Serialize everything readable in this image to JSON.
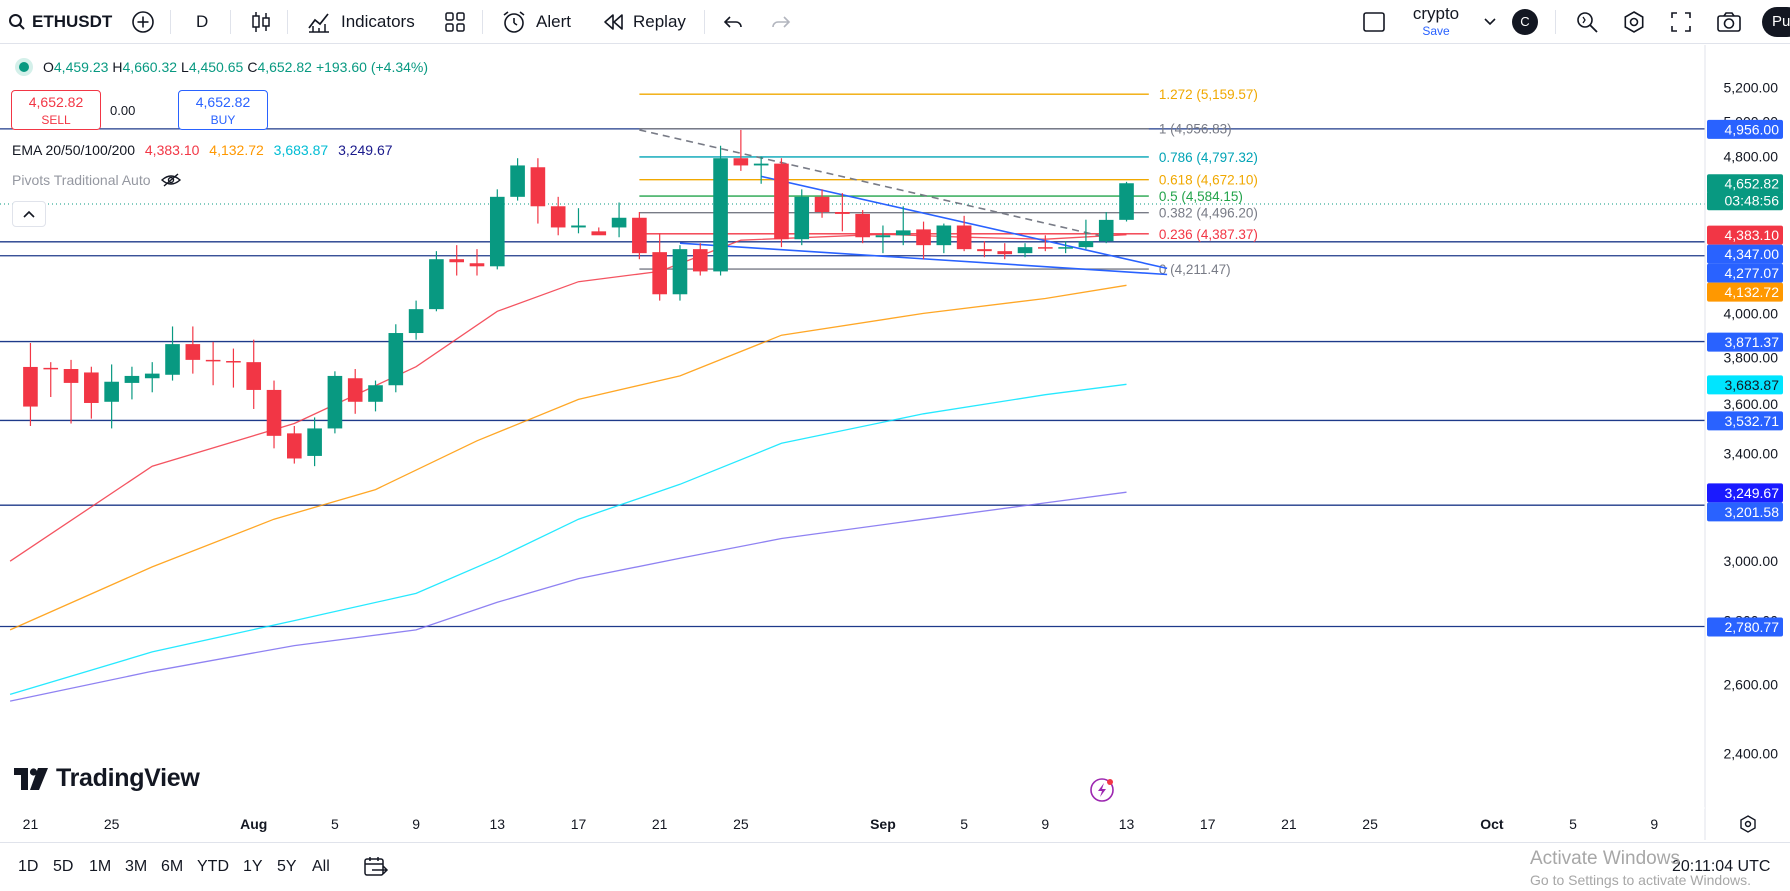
{
  "toolbar": {
    "symbol": "ETHUSDT",
    "interval": "D",
    "indicators_label": "Indicators",
    "alert_label": "Alert",
    "replay_label": "Replay",
    "layout_name": "crypto",
    "layout_save_label": "Save",
    "avatar_letter": "C",
    "publish_label": "Pu"
  },
  "legend": {
    "open_label": "O",
    "open": "4,459.23",
    "high_label": "H",
    "high": "4,660.32",
    "low_label": "L",
    "low": "4,450.65",
    "close_label": "C",
    "close": "4,652.82",
    "change": "+193.60 (+4.34%)"
  },
  "trade": {
    "sell_price": "4,652.82",
    "sell_label": "SELL",
    "buy_price": "4,652.82",
    "buy_label": "BUY",
    "spread": "0.00"
  },
  "ema": {
    "label": "EMA 20/50/100/200",
    "values": [
      "4,383.10",
      "4,132.72",
      "3,683.87",
      "3,249.67"
    ],
    "colors": [
      "#f23645",
      "#ff9800",
      "#00e5ff",
      "#3f2dbd"
    ]
  },
  "pivots_label": "Pivots Traditional Auto",
  "price_axis": {
    "ticks": [
      "5,200.00",
      "5,000.00",
      "4,800.00",
      "4,000.00",
      "3,800.00",
      "3,600.00",
      "3,400.00",
      "3,000.00",
      "2,800.00",
      "2,600.00",
      "2,400.00"
    ],
    "markers": [
      {
        "text": "4,956.00",
        "color": "#2962ff"
      },
      {
        "text": "4,652.82",
        "color": "#089981"
      },
      {
        "text": "03:48:56",
        "color": "#089981"
      },
      {
        "text": "4,383.10",
        "color": "#f23645"
      },
      {
        "text": "4,347.00",
        "color": "#2962ff"
      },
      {
        "text": "4,277.07",
        "color": "#2962ff"
      },
      {
        "text": "4,132.72",
        "color": "#ff9800"
      },
      {
        "text": "3,871.37",
        "color": "#2962ff"
      },
      {
        "text": "3,683.87",
        "color": "#00e5ff"
      },
      {
        "text": "3,532.71",
        "color": "#2962ff"
      },
      {
        "text": "3,249.67",
        "color": "#1a1aff"
      },
      {
        "text": "3,201.58",
        "color": "#2962ff"
      },
      {
        "text": "2,780.77",
        "color": "#2962ff"
      }
    ]
  },
  "time_axis": [
    "21",
    "25",
    "Aug",
    "5",
    "9",
    "13",
    "17",
    "21",
    "25",
    "Sep",
    "5",
    "9",
    "13",
    "17",
    "21",
    "25",
    "Oct",
    "5",
    "9"
  ],
  "fibonacci": [
    {
      "label": "1.272 (5,159.57)",
      "price": 5159.57,
      "color": "#f0a800"
    },
    {
      "label": "1 (4,956.83)",
      "price": 4956.83,
      "color": "#787b86"
    },
    {
      "label": "0.786 (4,797.32)",
      "price": 4797.32,
      "color": "#00a3b5"
    },
    {
      "label": "0.618 (4,672.10)",
      "price": 4672.1,
      "color": "#f0a800"
    },
    {
      "label": "0.5 (4,584.15)",
      "price": 4584.15,
      "color": "#22a34a"
    },
    {
      "label": "0.382 (4,496.20)",
      "price": 4496.2,
      "color": "#787b86"
    },
    {
      "label": "0.236 (4,387.37)",
      "price": 4387.37,
      "color": "#f23645"
    },
    {
      "label": "0 (4,211.47)",
      "price": 4211.47,
      "color": "#787b86"
    }
  ],
  "horizontal_levels": [
    4956.0,
    4347.0,
    4277.07,
    3871.37,
    3532.71,
    3201.58,
    2780.77
  ],
  "range_buttons": [
    "1D",
    "5D",
    "1M",
    "3M",
    "6M",
    "YTD",
    "1Y",
    "5Y",
    "All"
  ],
  "clock": "20:11:04 UTC",
  "logo_text": "TradingView",
  "watermark": {
    "line1": "Activate Windows",
    "line2": "Go to Settings to activate Windows."
  },
  "chart_data": {
    "type": "candlestick",
    "title": "ETHUSDT",
    "interval": "D",
    "y_scale": "log",
    "ylim": [
      2300,
      5350
    ],
    "x_start": "Jul 20",
    "x_end": "Oct 11",
    "candles": [
      {
        "d": "Jul 21",
        "o": 3759,
        "h": 3865,
        "l": 3510,
        "c": 3590
      },
      {
        "d": "Jul 22",
        "o": 3755,
        "h": 3780,
        "l": 3630,
        "c": 3752
      },
      {
        "d": "Jul 23",
        "o": 3750,
        "h": 3790,
        "l": 3520,
        "c": 3690
      },
      {
        "d": "Jul 24",
        "o": 3735,
        "h": 3760,
        "l": 3540,
        "c": 3605
      },
      {
        "d": "Jul 25",
        "o": 3610,
        "h": 3770,
        "l": 3500,
        "c": 3695
      },
      {
        "d": "Jul 26",
        "o": 3690,
        "h": 3760,
        "l": 3620,
        "c": 3720
      },
      {
        "d": "Jul 27",
        "o": 3710,
        "h": 3780,
        "l": 3650,
        "c": 3730
      },
      {
        "d": "Jul 28",
        "o": 3725,
        "h": 3940,
        "l": 3700,
        "c": 3860
      },
      {
        "d": "Jul 29",
        "o": 3860,
        "h": 3940,
        "l": 3730,
        "c": 3790
      },
      {
        "d": "Jul 30",
        "o": 3790,
        "h": 3870,
        "l": 3680,
        "c": 3785
      },
      {
        "d": "Jul 31",
        "o": 3785,
        "h": 3840,
        "l": 3670,
        "c": 3780
      },
      {
        "d": "Aug 1",
        "o": 3780,
        "h": 3880,
        "l": 3580,
        "c": 3660
      },
      {
        "d": "Aug 2",
        "o": 3660,
        "h": 3700,
        "l": 3420,
        "c": 3470
      },
      {
        "d": "Aug 3",
        "o": 3480,
        "h": 3510,
        "l": 3360,
        "c": 3380
      },
      {
        "d": "Aug 4",
        "o": 3390,
        "h": 3545,
        "l": 3350,
        "c": 3500
      },
      {
        "d": "Aug 5",
        "o": 3500,
        "h": 3740,
        "l": 3480,
        "c": 3720
      },
      {
        "d": "Aug 6",
        "o": 3710,
        "h": 3750,
        "l": 3560,
        "c": 3610
      },
      {
        "d": "Aug 7",
        "o": 3610,
        "h": 3700,
        "l": 3570,
        "c": 3680
      },
      {
        "d": "Aug 8",
        "o": 3680,
        "h": 3950,
        "l": 3650,
        "c": 3910
      },
      {
        "d": "Aug 9",
        "o": 3910,
        "h": 4060,
        "l": 3880,
        "c": 4020
      },
      {
        "d": "Aug 10",
        "o": 4020,
        "h": 4300,
        "l": 4010,
        "c": 4260
      },
      {
        "d": "Aug 11",
        "o": 4260,
        "h": 4330,
        "l": 4180,
        "c": 4245
      },
      {
        "d": "Aug 12",
        "o": 4240,
        "h": 4310,
        "l": 4180,
        "c": 4225
      },
      {
        "d": "Aug 13",
        "o": 4225,
        "h": 4620,
        "l": 4210,
        "c": 4580
      },
      {
        "d": "Aug 14",
        "o": 4580,
        "h": 4790,
        "l": 4560,
        "c": 4750
      },
      {
        "d": "Aug 15",
        "o": 4740,
        "h": 4790,
        "l": 4440,
        "c": 4530
      },
      {
        "d": "Aug 16",
        "o": 4530,
        "h": 4580,
        "l": 4380,
        "c": 4420
      },
      {
        "d": "Aug 17",
        "o": 4420,
        "h": 4520,
        "l": 4390,
        "c": 4430
      },
      {
        "d": "Aug 18",
        "o": 4400,
        "h": 4420,
        "l": 4390,
        "c": 4380
      },
      {
        "d": "Aug 19",
        "o": 4420,
        "h": 4550,
        "l": 4370,
        "c": 4470
      },
      {
        "d": "Aug 20",
        "o": 4470,
        "h": 4500,
        "l": 4260,
        "c": 4290
      },
      {
        "d": "Aug 21",
        "o": 4295,
        "h": 4390,
        "l": 4060,
        "c": 4090
      },
      {
        "d": "Aug 22",
        "o": 4090,
        "h": 4330,
        "l": 4060,
        "c": 4310
      },
      {
        "d": "Aug 23",
        "o": 4310,
        "h": 4340,
        "l": 4180,
        "c": 4200
      },
      {
        "d": "Aug 24",
        "o": 4200,
        "h": 4860,
        "l": 4180,
        "c": 4790
      },
      {
        "d": "Aug 25",
        "o": 4790,
        "h": 4950,
        "l": 4720,
        "c": 4750
      },
      {
        "d": "Aug 26",
        "o": 4750,
        "h": 4800,
        "l": 4650,
        "c": 4760
      },
      {
        "d": "Aug 27",
        "o": 4760,
        "h": 4790,
        "l": 4320,
        "c": 4360
      },
      {
        "d": "Aug 28",
        "o": 4360,
        "h": 4620,
        "l": 4330,
        "c": 4580
      },
      {
        "d": "Aug 29",
        "o": 4580,
        "h": 4620,
        "l": 4470,
        "c": 4500
      },
      {
        "d": "Aug 30",
        "o": 4500,
        "h": 4600,
        "l": 4400,
        "c": 4490
      },
      {
        "d": "Aug 31",
        "o": 4490,
        "h": 4510,
        "l": 4340,
        "c": 4370
      },
      {
        "d": "Sep 1",
        "o": 4370,
        "h": 4430,
        "l": 4290,
        "c": 4380
      },
      {
        "d": "Sep 2",
        "o": 4380,
        "h": 4530,
        "l": 4330,
        "c": 4405
      },
      {
        "d": "Sep 3",
        "o": 4410,
        "h": 4450,
        "l": 4260,
        "c": 4330
      },
      {
        "d": "Sep 4",
        "o": 4330,
        "h": 4440,
        "l": 4290,
        "c": 4430
      },
      {
        "d": "Sep 5",
        "o": 4430,
        "h": 4480,
        "l": 4300,
        "c": 4310
      },
      {
        "d": "Sep 6",
        "o": 4310,
        "h": 4350,
        "l": 4270,
        "c": 4300
      },
      {
        "d": "Sep 7",
        "o": 4300,
        "h": 4340,
        "l": 4260,
        "c": 4285
      },
      {
        "d": "Sep 8",
        "o": 4290,
        "h": 4340,
        "l": 4270,
        "c": 4320
      },
      {
        "d": "Sep 9",
        "o": 4320,
        "h": 4380,
        "l": 4300,
        "c": 4315
      },
      {
        "d": "Sep 10",
        "o": 4315,
        "h": 4350,
        "l": 4290,
        "c": 4320
      },
      {
        "d": "Sep 11",
        "o": 4320,
        "h": 4460,
        "l": 4310,
        "c": 4350
      },
      {
        "d": "Sep 12",
        "o": 4350,
        "h": 4500,
        "l": 4340,
        "c": 4459
      },
      {
        "d": "Sep 13",
        "o": 4459.23,
        "h": 4660.32,
        "l": 4450.65,
        "c": 4652.82
      }
    ],
    "ema_series": [
      {
        "name": "EMA 20",
        "color": "#f23645",
        "points": [
          [
            "Jul 20",
            3000
          ],
          [
            "Jul 27",
            3350
          ],
          [
            "Aug 3",
            3520
          ],
          [
            "Aug 9",
            3760
          ],
          [
            "Aug 13",
            4010
          ],
          [
            "Aug 17",
            4150
          ],
          [
            "Aug 21",
            4200
          ],
          [
            "Aug 25",
            4355
          ],
          [
            "Sep 1",
            4385
          ],
          [
            "Sep 5",
            4370
          ],
          [
            "Sep 9",
            4360
          ],
          [
            "Sep 13",
            4383
          ]
        ]
      },
      {
        "name": "EMA 50",
        "color": "#ff9800",
        "points": [
          [
            "Jul 20",
            2770
          ],
          [
            "Jul 27",
            2980
          ],
          [
            "Aug 2",
            3150
          ],
          [
            "Aug 7",
            3260
          ],
          [
            "Aug 12",
            3450
          ],
          [
            "Aug 17",
            3620
          ],
          [
            "Aug 22",
            3720
          ],
          [
            "Aug 27",
            3900
          ],
          [
            "Sep 3",
            4000
          ],
          [
            "Sep 9",
            4070
          ],
          [
            "Sep 13",
            4133
          ]
        ]
      },
      {
        "name": "EMA 100",
        "color": "#00e5ff",
        "points": [
          [
            "Jul 20",
            2570
          ],
          [
            "Jul 27",
            2700
          ],
          [
            "Aug 3",
            2800
          ],
          [
            "Aug 9",
            2890
          ],
          [
            "Aug 13",
            3010
          ],
          [
            "Aug 17",
            3150
          ],
          [
            "Aug 22",
            3280
          ],
          [
            "Aug 27",
            3440
          ],
          [
            "Sep 3",
            3560
          ],
          [
            "Sep 9",
            3640
          ],
          [
            "Sep 13",
            3684
          ]
        ]
      },
      {
        "name": "EMA 200",
        "color": "#7b6cf0",
        "points": [
          [
            "Jul 20",
            2550
          ],
          [
            "Jul 27",
            2640
          ],
          [
            "Aug 3",
            2720
          ],
          [
            "Aug 9",
            2770
          ],
          [
            "Aug 13",
            2860
          ],
          [
            "Aug 17",
            2940
          ],
          [
            "Aug 22",
            3010
          ],
          [
            "Aug 27",
            3080
          ],
          [
            "Sep 3",
            3150
          ],
          [
            "Sep 9",
            3210
          ],
          [
            "Sep 13",
            3250
          ]
        ]
      }
    ],
    "trendlines": [
      {
        "color": "#2962ff",
        "from": [
          "Aug 26",
          4690
        ],
        "to": [
          "Sep 15",
          4215
        ]
      },
      {
        "color": "#2962ff",
        "from": [
          "Aug 22",
          4340
        ],
        "to": [
          "Sep 15",
          4185
        ]
      },
      {
        "color": "#787b86",
        "dashed": true,
        "from": [
          "Aug 20",
          4950
        ],
        "to": [
          "Sep 12",
          4370
        ]
      }
    ],
    "grid": false
  }
}
